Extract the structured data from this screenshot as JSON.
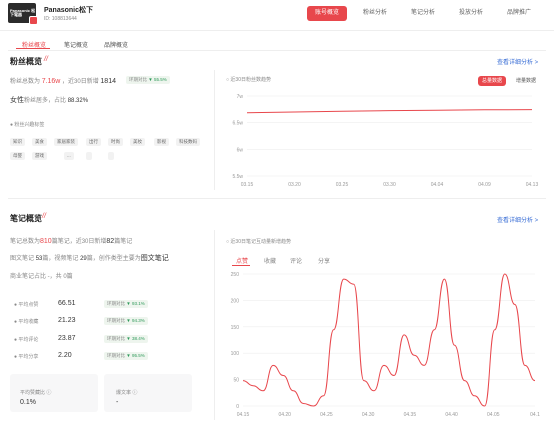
{
  "header": {
    "brand": "Panasonic松下",
    "id": "ID: 108813644",
    "logo_text": "Panasonic 松下電器",
    "tabs": [
      "账号概览",
      "粉丝分析",
      "笔记分析",
      "投放分析",
      "品牌推广"
    ]
  },
  "subtabs": [
    "粉丝概览",
    "笔记概览",
    "品牌概览"
  ],
  "fans": {
    "title": "粉丝概览",
    "more": "查看详细分析 >",
    "total_label": "粉丝总数为",
    "total_value": "7.16w",
    "recent_label": "，近30日新增",
    "recent_value": "1814",
    "compare_label": "环期对比",
    "compare_value": "▼ 55.5%",
    "gender_label": "女性",
    "gender_text": "粉丝居多，占比",
    "gender_value": "88.32%",
    "interest_label": "粉丝兴趣标签",
    "tags": [
      "知识",
      "美食",
      "家居家装",
      "出行",
      "时尚",
      "美妆",
      "影视",
      "科技数码",
      "母婴",
      "游戏",
      "..."
    ],
    "chart_title": "近30日粉丝数趋势",
    "btn_total": "总量数据",
    "btn_inc": "增量数据"
  },
  "notes": {
    "title": "笔记概览",
    "more": "查看详细分析 >",
    "line1_a": "笔记总数为",
    "line1_b": "810",
    "line1_c": "篇笔记，近30日新增",
    "line1_d": "82",
    "line1_e": "篇笔记",
    "line2_a": "图文笔记",
    "line2_b": "53",
    "line2_c": "篇，视频笔记",
    "line2_d": "29",
    "line2_e": "篇，创作类型主要为",
    "line2_f": "图文笔记",
    "line3": "商业笔记占比 -，共 0篇",
    "metrics": [
      {
        "label": "平均点赞",
        "value": "66.51",
        "cmp": "▼ 93.1%"
      },
      {
        "label": "平均收藏",
        "value": "21.23",
        "cmp": "▼ 94.3%"
      },
      {
        "label": "平均评论",
        "value": "23.87",
        "cmp": "▼ 38.4%"
      },
      {
        "label": "平均分享",
        "value": "2.20",
        "cmp": "▼ 95.5%"
      }
    ],
    "cmp_label": "环期对比",
    "box1_label": "平均赞藏比 ⓘ",
    "box1_value": "0.1%",
    "box2_label": "爆文率 ⓘ",
    "box2_value": "-",
    "chart_title": "近30日笔记互动量新增趋势",
    "chart_tabs": [
      "点赞",
      "收藏",
      "评论",
      "分享"
    ]
  },
  "chart_data": [
    {
      "type": "line",
      "x": [
        "03.15",
        "03.20",
        "03.25",
        "03.30",
        "04.04",
        "04.09",
        "04.13"
      ],
      "y": [
        70800,
        71000,
        71200,
        71350,
        71450,
        71550,
        71600
      ],
      "ylim": [
        55000,
        75000
      ],
      "yticks": [
        "7w",
        "6.5w",
        "6w",
        "5.5w"
      ],
      "color": "#e8474c"
    },
    {
      "type": "line",
      "x": [
        "04.15",
        "04.20",
        "04.25",
        "04.30",
        "04.35",
        "04.40",
        "04.05",
        "04.1"
      ],
      "yticks": [
        "250",
        "200",
        "150",
        "100",
        "50",
        "0"
      ],
      "ylim": [
        0,
        260
      ],
      "values": [
        50,
        40,
        30,
        80,
        60,
        30,
        5,
        0,
        20,
        150,
        250,
        240,
        50,
        30,
        80,
        60,
        140,
        100,
        80,
        150,
        250,
        120,
        50,
        20,
        0,
        150,
        260,
        200,
        80,
        50
      ],
      "color": "#e8474c"
    }
  ]
}
